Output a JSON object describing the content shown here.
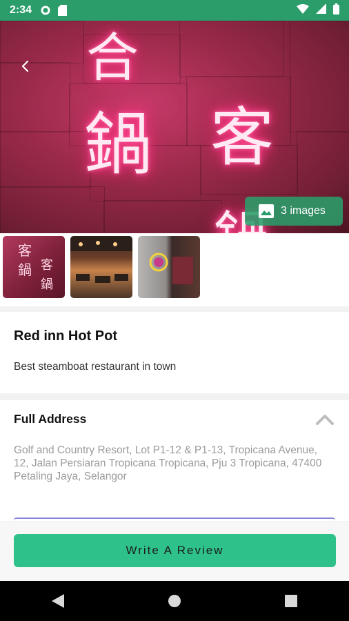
{
  "status_bar": {
    "time": "2:34",
    "icons": [
      "settings-icon",
      "sd-card-icon",
      "wifi-icon",
      "signal-icon",
      "battery-icon"
    ]
  },
  "hero": {
    "neon_glyphs_left": [
      "合",
      "鍋"
    ],
    "neon_glyphs_right": [
      "客",
      "鍋"
    ],
    "images_badge_label": "3 images"
  },
  "thumbnails": [
    {
      "name": "thumb-neon-sign"
    },
    {
      "name": "thumb-dining-hall"
    },
    {
      "name": "thumb-entrance"
    }
  ],
  "restaurant": {
    "name": "Red inn Hot Pot",
    "description": "Best steamboat restaurant in town"
  },
  "address": {
    "heading": "Full Address",
    "text": "Golf and Country Resort, Lot P1-12 & P1-13, Tropicana Avenue, 12, Jalan Persiaran Tropicana Tropicana, Pju 3 Tropicana, 47400 Petaling Jaya, Selangor"
  },
  "actions": {
    "write_review_label": "Write A Review"
  },
  "colors": {
    "primary": "#2ec18a",
    "status_bar": "#2a9d6a"
  }
}
